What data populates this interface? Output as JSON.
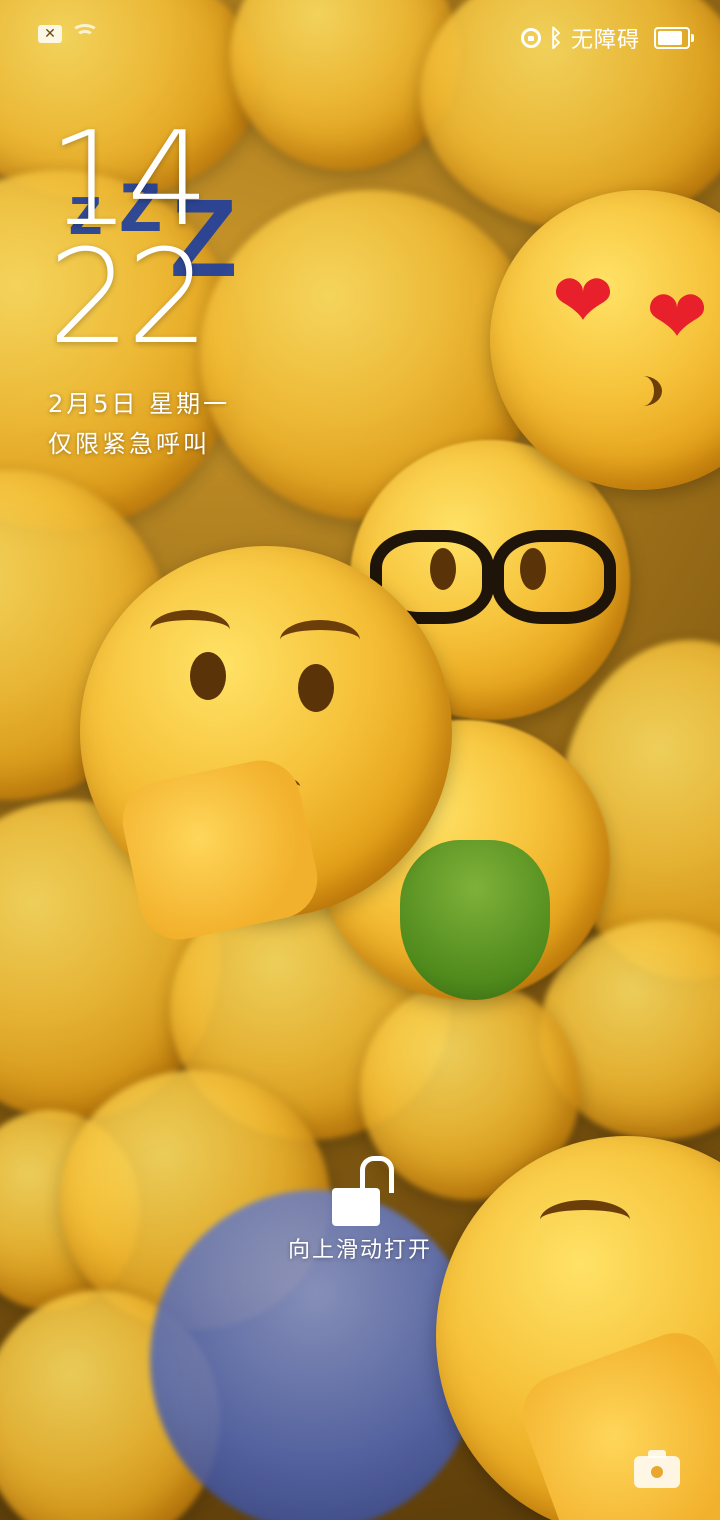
{
  "status_bar": {
    "sim_icon": "sim-error-icon",
    "wifi_icon": "wifi-icon",
    "rotation_lock_icon": "rotation-lock-icon",
    "bluetooth_icon": "bluetooth-icon",
    "bluetooth_glyph": "ᛒ",
    "carrier": "无障碍",
    "battery_icon": "battery-icon",
    "battery_level": 0.85
  },
  "lockscreen": {
    "hour": "14",
    "minute": "22",
    "date": "2月5日 星期一",
    "emergency_note": "仅限紧急呼叫",
    "unlock_hint": "向上滑动打开",
    "unlock_icon": "unlock-padlock-icon",
    "camera_icon": "camera-icon"
  },
  "wallpaper": {
    "description_icon": "emoji-collage-wallpaper",
    "heart_glyph": "❤",
    "zzz_glyph": "z",
    "zzz_big": "Z"
  }
}
